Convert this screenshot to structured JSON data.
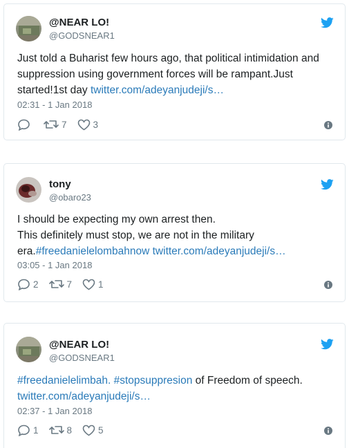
{
  "tweets": [
    {
      "name": "@NEAR LO!",
      "handle": "@GODSNEAR1",
      "text_lines": [
        "Just told a Buharist few hours ago, that political intimidation and",
        "suppression using government forces will be rampant.Just"
      ],
      "line3_text": "started!1st day ",
      "line3_link": "twitter.com/adeyanjudeji/s…",
      "timestamp": "02:31 - 1 Jan 2018",
      "reply_count": "",
      "retweet_count": "7",
      "like_count": "3",
      "avatar_icon": "avatar-photo-icon"
    },
    {
      "name": "tony",
      "handle": "@obaro23",
      "text_lines": [
        "I should be expecting my own arrest then.",
        "This definitely must stop, we are not in the military"
      ],
      "line3_text": "era.",
      "line3_hashtag": "#freedanielelombahnow",
      "line3_link": " twitter.com/adeyanjudeji/s…",
      "timestamp": "03:05 - 1 Jan 2018",
      "reply_count": "2",
      "retweet_count": "7",
      "like_count": "1",
      "avatar_icon": "avatar-photo-icon"
    },
    {
      "name": "@NEAR LO!",
      "handle": "@GODSNEAR1",
      "line1_hashtag1": "#freedanielelimbah.",
      "line1_space": " ",
      "line1_hashtag2": "#stopsuppresion",
      "line1_text": " of Freedom of speech.",
      "line2_link": "twitter.com/adeyanjudeji/s…",
      "timestamp": "02:37 - 1 Jan 2018",
      "reply_count": "1",
      "retweet_count": "8",
      "like_count": "5",
      "avatar_icon": "avatar-photo-icon"
    }
  ],
  "colors": {
    "text": "#1c2022",
    "muted": "#697882",
    "link": "#2b7bb9",
    "twitter_blue": "#1da1f2",
    "border": "#e1e8ed"
  },
  "icons": {
    "brand": "twitter-bird-icon",
    "reply": "reply-icon",
    "retweet": "retweet-icon",
    "like": "heart-icon",
    "info": "info-icon"
  }
}
